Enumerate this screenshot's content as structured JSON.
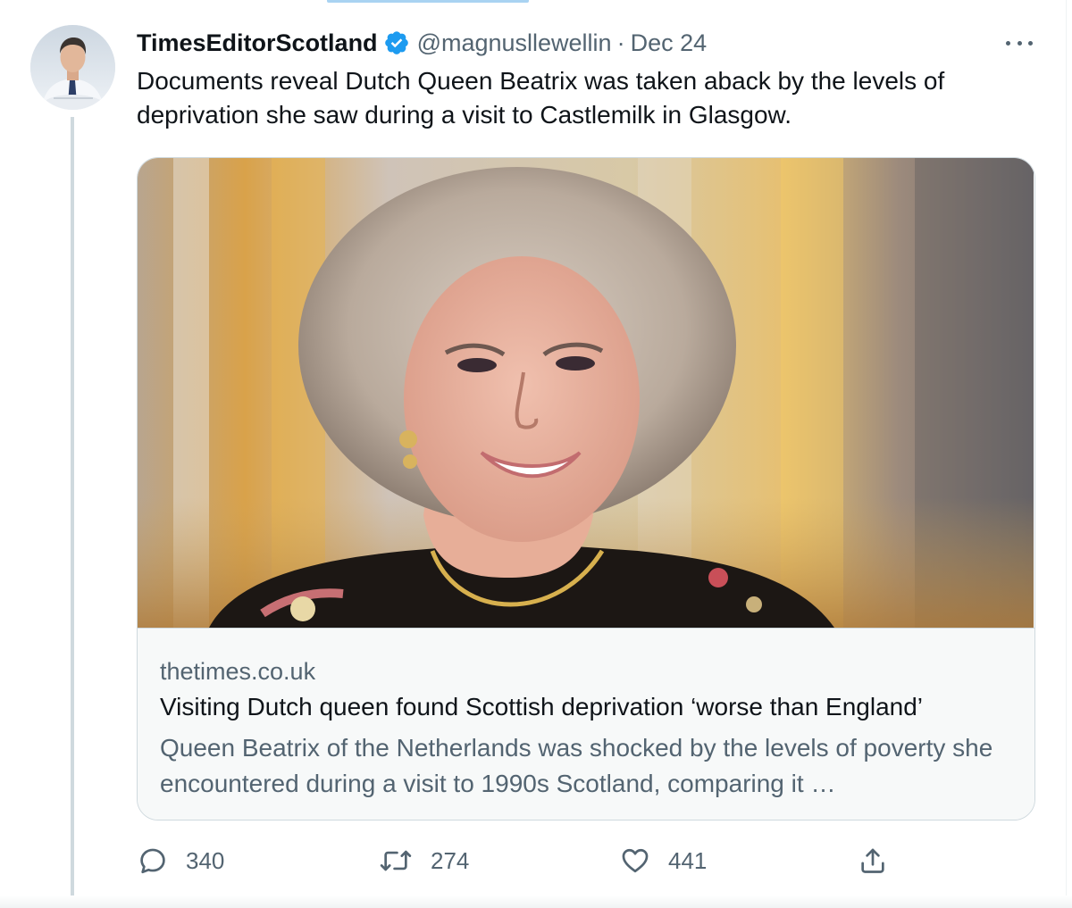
{
  "tweet": {
    "display_name": "TimesEditorScotland",
    "handle": "@magnusllewellin",
    "separator": "·",
    "date": "Dec 24",
    "text": "Documents reveal Dutch Queen Beatrix was taken aback by the levels of deprivation she saw during a visit to Castlemilk in Glasgow."
  },
  "card": {
    "domain": "thetimes.co.uk",
    "title": "Visiting Dutch queen found Scottish deprivation ‘worse than England’",
    "description": "Queen Beatrix of the Netherlands was shocked by the levels of poverty she encountered during a visit to 1990s Scotland, comparing it …"
  },
  "actions": {
    "replies": "340",
    "retweets": "274",
    "likes": "441"
  },
  "icons": {
    "verified": "verified-badge-icon",
    "more": "more-icon",
    "reply": "reply-icon",
    "retweet": "retweet-icon",
    "like": "like-icon",
    "share": "share-icon"
  },
  "colors": {
    "verified_blue": "#1d9bf0",
    "secondary_text": "#536471",
    "primary_text": "#0f1419",
    "border": "#cfd9de"
  }
}
